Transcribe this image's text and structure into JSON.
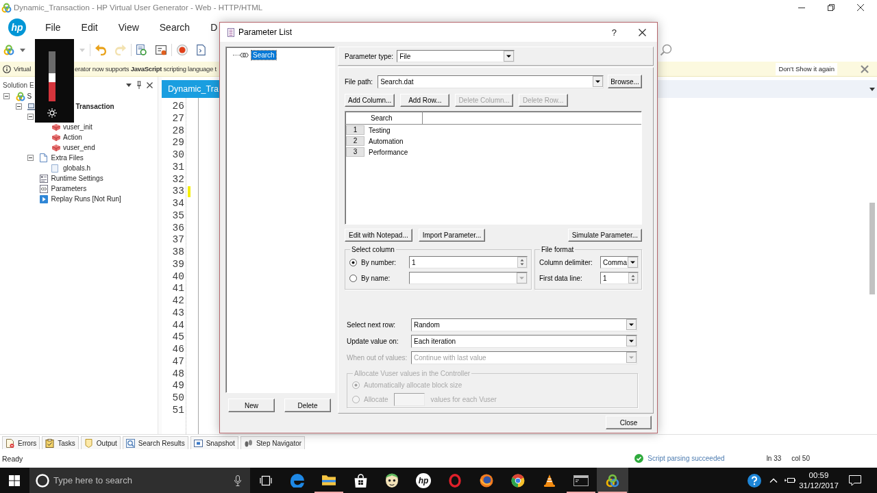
{
  "window": {
    "title": "Dynamic_Transaction - HP Virtual User Generator - Web - HTTP/HTML"
  },
  "menu_bar": {
    "logo": "hp",
    "items": [
      "File",
      "Edit",
      "View",
      "Search",
      "D"
    ]
  },
  "toolbar": {
    "groups": [
      [
        {
          "kind": "logo",
          "disabled": false
        },
        {
          "kind": "caret",
          "disabled": false
        }
      ],
      [
        {
          "kind": "caret",
          "disabled": true
        }
      ],
      [
        {
          "kind": "undo",
          "disabled": false
        },
        {
          "kind": "redo",
          "disabled": true
        }
      ],
      [
        {
          "kind": "script",
          "disabled": false
        },
        {
          "kind": "report",
          "disabled": false
        }
      ],
      [
        {
          "kind": "record",
          "disabled": false
        },
        {
          "kind": "page",
          "disabled": false
        }
      ]
    ]
  },
  "info_bar": {
    "message_parts": [
      "Virtual",
      "erator now supports **JavaScript** scripting language t"
    ],
    "dismiss_button": "Don't Show it again"
  },
  "brightness_popup": {
    "level": 0.56
  },
  "solution_explorer": {
    "title": "Solution E",
    "tree": [
      {
        "label": "S",
        "kind": "solution",
        "expanded": true,
        "children": [
          {
            "label": "Transaction",
            "kind": "project",
            "expanded": true,
            "children": [
              {
                "expanded": true,
                "children": [
                  {
                    "label": "vuser_init",
                    "kind": "action"
                  },
                  {
                    "label": "Action",
                    "kind": "action"
                  },
                  {
                    "label": "vuser_end",
                    "kind": "action"
                  }
                ]
              },
              {
                "label": "Extra Files",
                "kind": "files",
                "expanded": true,
                "children": [
                  {
                    "label": "globals.h",
                    "kind": "file"
                  }
                ]
              },
              {
                "label": "Runtime Settings",
                "kind": "settings"
              },
              {
                "label": "Parameters",
                "kind": "parameters"
              },
              {
                "label": "Replay Runs [Not Run]",
                "kind": "replay"
              }
            ]
          }
        ]
      }
    ]
  },
  "editor": {
    "tab": {
      "label": "Dynamic_Tra",
      "selected": true
    },
    "lines": [
      {
        "number": "26",
        "changed": false
      },
      {
        "number": "27",
        "changed": false
      },
      {
        "number": "28",
        "changed": false
      },
      {
        "number": "29",
        "changed": false
      },
      {
        "number": "30",
        "changed": false
      },
      {
        "number": "31",
        "changed": false
      },
      {
        "number": "32",
        "changed": false
      },
      {
        "number": "33",
        "changed": true
      },
      {
        "number": "34",
        "changed": false
      },
      {
        "number": "35",
        "changed": false
      },
      {
        "number": "36",
        "changed": false
      },
      {
        "number": "37",
        "changed": false
      },
      {
        "number": "38",
        "changed": false
      },
      {
        "number": "39",
        "changed": false
      },
      {
        "number": "40",
        "changed": false
      },
      {
        "number": "41",
        "changed": false
      },
      {
        "number": "42",
        "changed": false
      },
      {
        "number": "43",
        "changed": false
      },
      {
        "number": "44",
        "changed": false
      },
      {
        "number": "45",
        "changed": false
      },
      {
        "number": "46",
        "changed": false
      },
      {
        "number": "47",
        "changed": false
      },
      {
        "number": "48",
        "changed": false
      },
      {
        "number": "49",
        "changed": false
      },
      {
        "number": "50",
        "changed": false
      },
      {
        "number": "51",
        "changed": false
      }
    ]
  },
  "bottom_tabs": [
    {
      "label": "Errors",
      "kind": "errors"
    },
    {
      "label": "Tasks",
      "kind": "tasks"
    },
    {
      "label": "Output",
      "kind": "output"
    },
    {
      "label": "Search Results",
      "kind": "search"
    },
    {
      "label": "Snapshot",
      "kind": "snapshot"
    },
    {
      "label": "Step Navigator",
      "kind": "steps"
    }
  ],
  "status_bar": {
    "text": "Ready",
    "parse_status": {
      "text": "Script parsing succeeded",
      "ok": true
    },
    "line": "ln 33",
    "column": "col 50"
  },
  "taskbar": {
    "search_placeholder": "Type here to search",
    "apps": [
      {
        "kind": "taskview",
        "open": false,
        "active": false
      },
      {
        "kind": "edge",
        "open": false,
        "active": false
      },
      {
        "kind": "explorer",
        "open": true,
        "active": false
      },
      {
        "kind": "store",
        "open": false,
        "active": false
      },
      {
        "kind": "cartoon",
        "open": false,
        "active": false
      },
      {
        "kind": "hp",
        "logo": "hp",
        "open": false,
        "active": false
      },
      {
        "kind": "opera",
        "open": false,
        "active": false
      },
      {
        "kind": "firefox",
        "open": false,
        "active": false
      },
      {
        "kind": "chrome",
        "open": false,
        "active": false
      },
      {
        "kind": "vlc",
        "open": false,
        "active": false
      },
      {
        "kind": "terminal",
        "open": true,
        "active": false
      },
      {
        "kind": "vugen",
        "open": true,
        "active": true
      }
    ],
    "time": "00:59",
    "date": "31/12/2017"
  },
  "dialog": {
    "title": "Parameter List",
    "help_button": "?",
    "parameters": [
      {
        "label": "Search",
        "selected": true
      }
    ],
    "tree_buttons": [
      "New",
      "Delete"
    ],
    "parameter_type": {
      "label": "Parameter type:",
      "value": "File"
    },
    "file_path": {
      "label": "File path:",
      "value": "Search.dat",
      "button": "Browse..."
    },
    "table_buttons": [
      {
        "label": "Add Column...",
        "disabled": false
      },
      {
        "label": "Add Row...",
        "disabled": false
      },
      {
        "label": "Delete Column...",
        "disabled": true
      },
      {
        "label": "Delete Row...",
        "disabled": true
      }
    ],
    "table": {
      "columns": [
        "Search"
      ],
      "rows": [
        {
          "number": "1",
          "cells": [
            "Testing"
          ]
        },
        {
          "number": "2",
          "cells": [
            "Automation"
          ]
        },
        {
          "number": "3",
          "cells": [
            "Performance"
          ]
        }
      ]
    },
    "file_buttons": [
      {
        "label": "Edit with Notepad...",
        "disabled": false
      },
      {
        "label": "Import Parameter...",
        "disabled": false
      },
      {
        "label": "Simulate Parameter...",
        "disabled": false
      }
    ],
    "select_column": {
      "title": "Select column",
      "options": [
        {
          "label": "By number:",
          "selected": true,
          "kind": "spin",
          "value": "1",
          "disabled": false
        },
        {
          "label": "By name:",
          "selected": false,
          "kind": "combo",
          "disabled": true
        }
      ]
    },
    "file_format": {
      "title": "File format",
      "fields": [
        {
          "label": "Column delimiter:",
          "kind": "combo",
          "value": "Comma"
        },
        {
          "label": "First data line:",
          "kind": "spin",
          "value": "1"
        }
      ]
    },
    "row_settings": [
      {
        "label": "Select next row:",
        "value": "Random",
        "disabled": false
      },
      {
        "label": "Update value on:",
        "value": "Each iteration",
        "disabled": false
      },
      {
        "label": "When out of values:",
        "value": "Continue with last value",
        "disabled": true
      }
    ],
    "allocation": {
      "title": "Allocate Vuser values in the Controller",
      "disabled": true,
      "options": [
        {
          "label": "Automatically allocate block size",
          "selected": true
        },
        {
          "label": "Allocate",
          "suffix": "values for each Vuser",
          "selected": false
        }
      ]
    },
    "close_button": "Close"
  }
}
